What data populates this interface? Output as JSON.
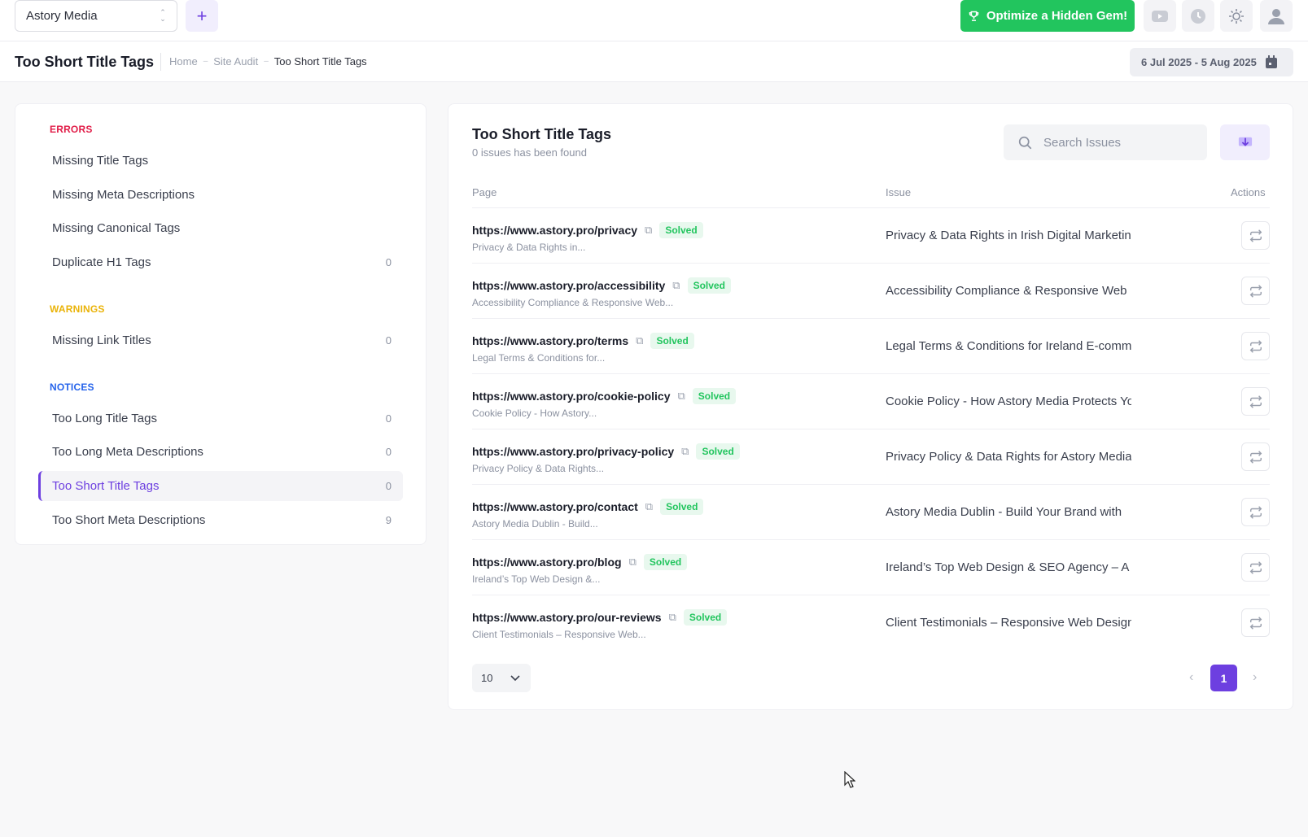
{
  "topbar": {
    "project": "Astory Media",
    "add_label": "+",
    "optimize_label": "Optimize a Hidden Gem!",
    "icons": [
      "youtube-icon",
      "clock-icon",
      "sun-icon",
      "user-icon"
    ]
  },
  "subheader": {
    "title": "Too Short Title Tags",
    "breadcrumb": [
      "Home",
      "Site Audit",
      "Too Short Title Tags"
    ],
    "date_range": "6 Jul 2025 - 5 Aug 2025"
  },
  "sidebar": {
    "groups": [
      {
        "title": "ERRORS",
        "color": "#e11d48",
        "items": [
          {
            "label": "Missing Title Tags",
            "count": ""
          },
          {
            "label": "Missing Meta Descriptions",
            "count": ""
          },
          {
            "label": "Missing Canonical Tags",
            "count": ""
          },
          {
            "label": "Duplicate H1 Tags",
            "count": "0"
          }
        ]
      },
      {
        "title": "WARNINGS",
        "color": "#eab308",
        "items": [
          {
            "label": "Missing Link Titles",
            "count": "0"
          }
        ]
      },
      {
        "title": "NOTICES",
        "color": "#2563eb",
        "items": [
          {
            "label": "Too Long Title Tags",
            "count": "0"
          },
          {
            "label": "Too Long Meta Descriptions",
            "count": "0"
          },
          {
            "label": "Too Short Title Tags",
            "count": "0"
          },
          {
            "label": "Too Short Meta Descriptions",
            "count": "9"
          }
        ]
      }
    ]
  },
  "main": {
    "title": "Too Short Title Tags",
    "subtitle": "0 issues has been found",
    "search_placeholder": "Search Issues",
    "columns": [
      "Page",
      "Issue",
      "Actions"
    ],
    "rows": [
      {
        "url": "https://www.astory.pro/privacy",
        "status": "Solved",
        "title": "Privacy & Data Rights in...",
        "issue": "Privacy & Data Rights in Irish Digital Marketing"
      },
      {
        "url": "https://www.astory.pro/accessibility",
        "status": "Solved",
        "title": "Accessibility Compliance & Responsive Web...",
        "issue": "Accessibility Compliance & Responsive Web"
      },
      {
        "url": "https://www.astory.pro/terms",
        "status": "Solved",
        "title": "Legal Terms & Conditions for...",
        "issue": "Legal Terms & Conditions for Ireland E-commerce"
      },
      {
        "url": "https://www.astory.pro/cookie-policy",
        "status": "Solved",
        "title": "Cookie Policy - How Astory...",
        "issue": "Cookie Policy - How Astory Media Protects Your"
      },
      {
        "url": "https://www.astory.pro/privacy-policy",
        "status": "Solved",
        "title": "Privacy Policy & Data Rights...",
        "issue": "Privacy Policy & Data Rights for Astory Media"
      },
      {
        "url": "https://www.astory.pro/contact",
        "status": "Solved",
        "title": "Astory Media Dublin - Build...",
        "issue": "Astory Media Dublin - Build Your Brand with"
      },
      {
        "url": "https://www.astory.pro/blog",
        "status": "Solved",
        "title": "Ireland’s Top Web Design &...",
        "issue": "Ireland’s Top Web Design & SEO Agency – A"
      },
      {
        "url": "https://www.astory.pro/our-reviews",
        "status": "Solved",
        "title": "Client Testimonials – Responsive Web...",
        "issue": "Client Testimonials – Responsive Web Design"
      }
    ],
    "per_page": "10",
    "current_page": "1"
  }
}
